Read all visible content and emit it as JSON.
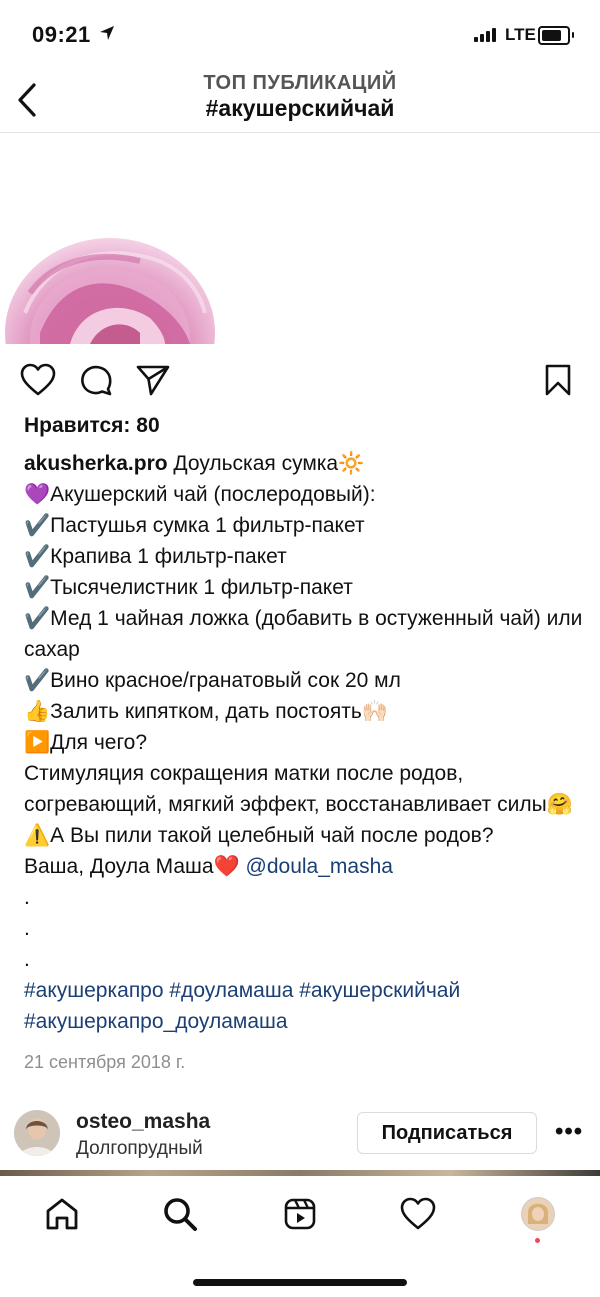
{
  "status_bar": {
    "time": "09:21",
    "network": "LTE"
  },
  "header": {
    "subtitle": "ТОП ПУБЛИКАЦИЙ",
    "title": "#акушерскийчай"
  },
  "post": {
    "likes_text": "Нравится: 80",
    "author": "akusherka.pro",
    "caption_first": " Доульская сумка🔆",
    "caption_lines": [
      "💜Акушерский чай (послеродовый):",
      "✔️Пастушья сумка 1 фильтр-пакет",
      "✔️Крапива 1 фильтр-пакет",
      "✔️Тысячелистник 1 фильтр-пакет",
      "✔️Мед 1 чайная ложка (добавить в остуженный чай) или сахар",
      "✔️Вино красное/гранатовый сок 20 мл",
      "👍Залить кипятком, дать постоять🙌🏻",
      "▶️Для чего?",
      "Стимуляция сокращения матки после родов, согревающий, мягкий эффект, восстанавливает силы🤗",
      "⚠️А Вы пили такой целебный чай после родов?"
    ],
    "signoff": "Ваша, Доула Маша❤️ ",
    "mention": "@doula_masha",
    "dots": [
      ".",
      ".",
      "."
    ],
    "hashtags_line1": "#акушеркапро #доуламаша #акушерскийчай",
    "hashtags_line2": "#акушеркапро_доуламаша",
    "date": "21 сентября 2018 г."
  },
  "next_post": {
    "username": "osteo_masha",
    "location": "Долгопрудный",
    "follow_label": "Подписаться",
    "more_label": "•••"
  },
  "icons": {
    "back": "chevron-left-icon",
    "like": "heart-icon",
    "comment": "comment-bubble-icon",
    "share": "paper-plane-icon",
    "save": "bookmark-icon",
    "tabs": [
      "home-icon",
      "search-icon",
      "reels-icon",
      "heart-icon",
      "profile-avatar"
    ]
  },
  "colors": {
    "link": "#1b3f74",
    "meta": "#8e8e8e",
    "notification": "#ed4956"
  }
}
